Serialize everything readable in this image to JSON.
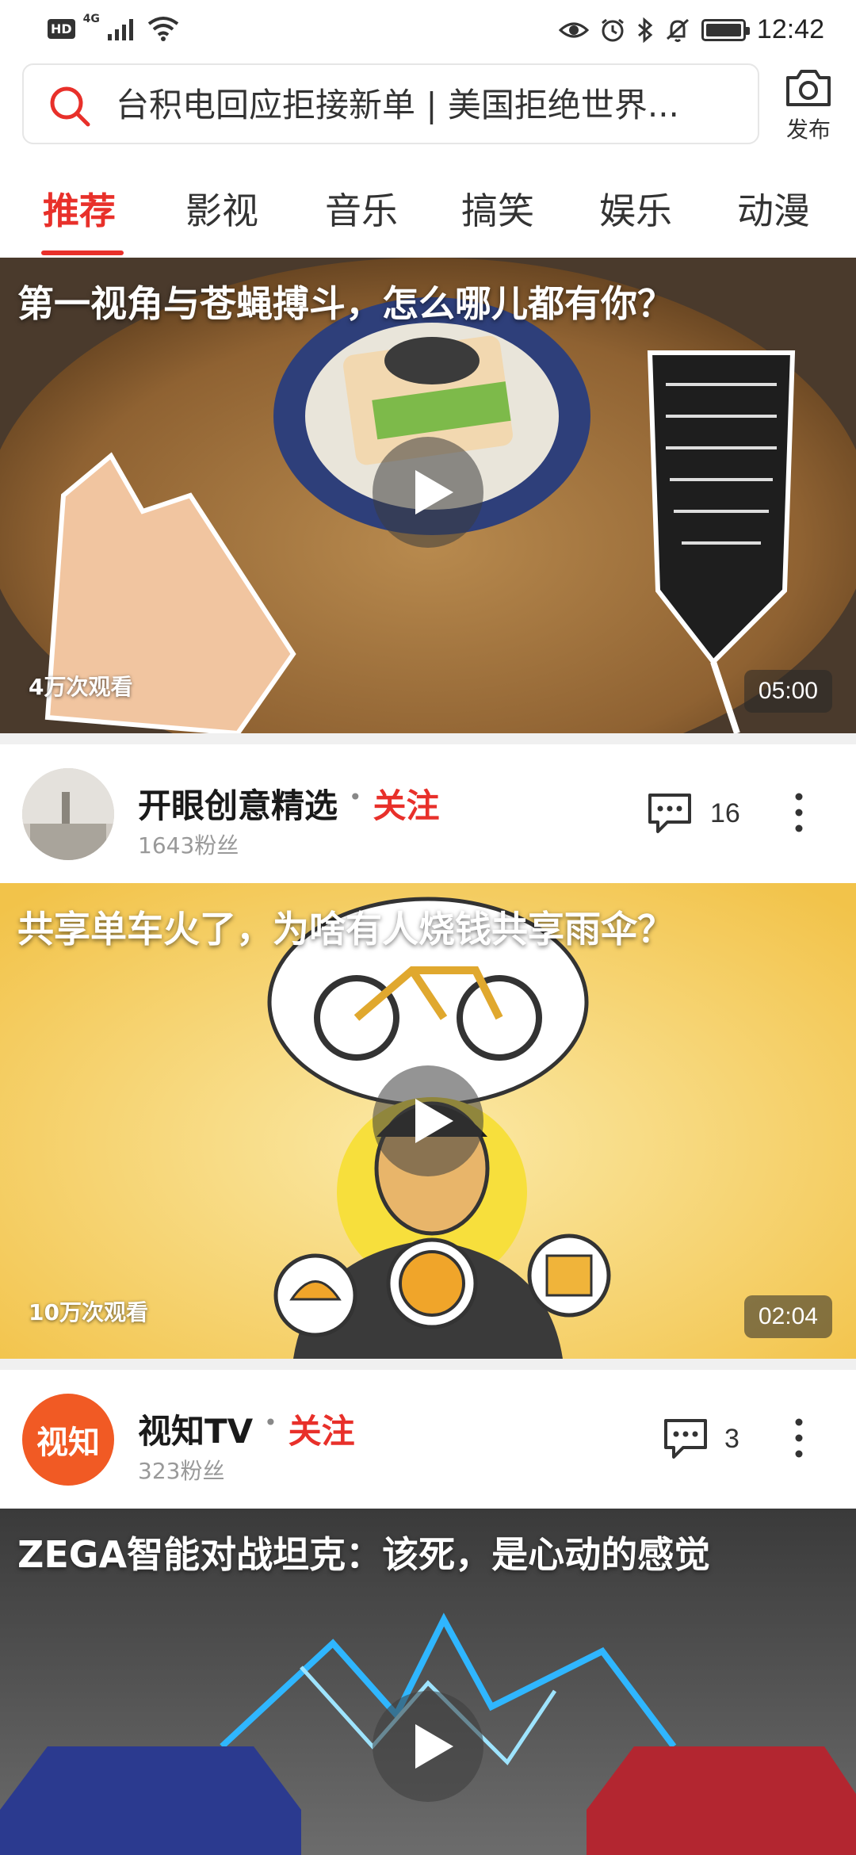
{
  "status_bar": {
    "hd": "HD",
    "network": "4G",
    "time": "12:42",
    "icons": [
      "signal-icon",
      "wifi-icon",
      "eye-comfort-icon",
      "alarm-icon",
      "bluetooth-icon",
      "mute-icon",
      "battery-icon"
    ]
  },
  "search": {
    "text": "台积电回应拒接新单 | 美国拒绝世界...",
    "icon": "search-icon"
  },
  "publish": {
    "label": "发布",
    "icon": "camera-icon"
  },
  "tabs": [
    {
      "label": "推荐",
      "active": true
    },
    {
      "label": "影视",
      "active": false
    },
    {
      "label": "音乐",
      "active": false
    },
    {
      "label": "搞笑",
      "active": false
    },
    {
      "label": "娱乐",
      "active": false
    },
    {
      "label": "动漫",
      "active": false
    }
  ],
  "feed": [
    {
      "title": "第一视角与苍蝇搏斗，怎么哪儿都有你？",
      "views": "4万次观看",
      "duration": "05:00",
      "author": "开眼创意精选",
      "follow": "关注",
      "fans": "1643粉丝",
      "comments": "16"
    },
    {
      "title": "共享单车火了，为啥有人烧钱共享雨伞？",
      "views": "10万次观看",
      "duration": "02:04",
      "author": "视知TV",
      "follow": "关注",
      "fans": "323粉丝",
      "comments": "3",
      "avatar_text": "视知"
    },
    {
      "title": "ZEGA智能对战坦克：该死，是心动的感觉"
    }
  ],
  "colors": {
    "accent": "#e8302a",
    "text_primary": "#1a1a1a",
    "text_secondary": "#999999",
    "divider": "#f0f0f0"
  }
}
